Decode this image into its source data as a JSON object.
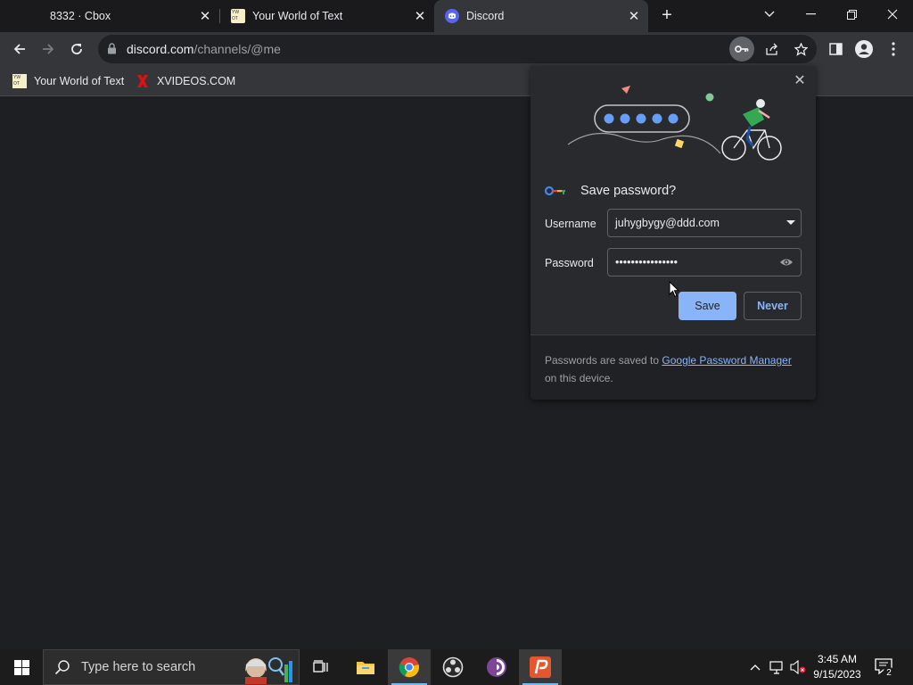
{
  "tabs": [
    {
      "title": "8332 · Cbox",
      "active": false
    },
    {
      "title": "Your World of Text",
      "active": false
    },
    {
      "title": "Discord",
      "active": true
    }
  ],
  "toolbar": {
    "url_host": "discord.com",
    "url_path": "/channels/@me"
  },
  "bookmarks": [
    {
      "label": "Your World of Text"
    },
    {
      "label": "XVIDEOS.COM"
    }
  ],
  "password_popup": {
    "title": "Save password?",
    "username_label": "Username",
    "username_value": "juhygbygy@ddd.com",
    "password_label": "Password",
    "password_value": "••••••••••••••••",
    "save_label": "Save",
    "never_label": "Never",
    "footer_prefix": "Passwords are saved to ",
    "footer_link": "Google Password Manager",
    "footer_suffix": " on this device."
  },
  "taskbar": {
    "search_placeholder": "Type here to search",
    "time": "3:45 AM",
    "date": "9/15/2023",
    "notification_count": "2"
  },
  "colors": {
    "accent": "#8ab4f8",
    "discord": "#5865f2",
    "taskbar_active": "#76b9ed"
  }
}
